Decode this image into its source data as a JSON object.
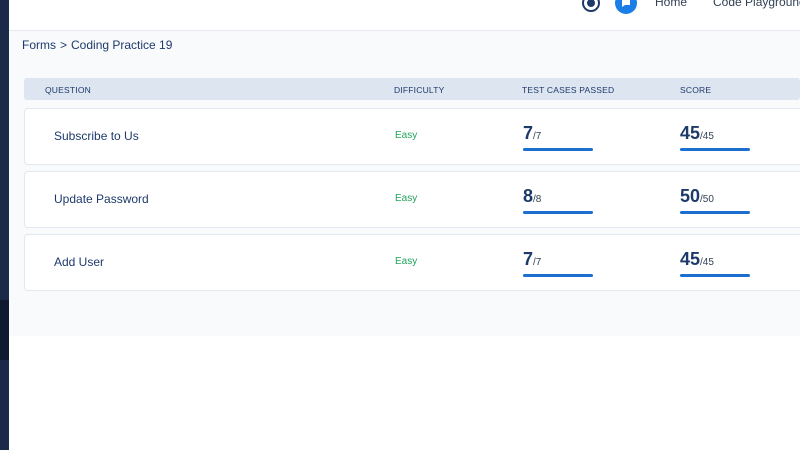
{
  "nav": {
    "links": [
      "Home",
      "Code Playground"
    ],
    "icons": [
      "streak-icon",
      "chat-icon"
    ]
  },
  "breadcrumb": {
    "parent": "Forms",
    "separator": ">",
    "current": "Coding Practice 19"
  },
  "table": {
    "headers": {
      "question": "QUESTION",
      "difficulty": "DIFFICULTY",
      "tests": "TEST CASES PASSED",
      "score": "SCORE"
    },
    "rows": [
      {
        "question": "Subscribe to Us",
        "difficulty": "Easy",
        "tests_passed": "7",
        "tests_total": "/7",
        "score": "45",
        "score_total": "/45",
        "tests_progress": 1,
        "score_progress": 1
      },
      {
        "question": "Update Password",
        "difficulty": "Easy",
        "tests_passed": "8",
        "tests_total": "/8",
        "score": "50",
        "score_total": "/50",
        "tests_progress": 1,
        "score_progress": 1
      },
      {
        "question": "Add User",
        "difficulty": "Easy",
        "tests_passed": "7",
        "tests_total": "/7",
        "score": "45",
        "score_total": "/45",
        "tests_progress": 1,
        "score_progress": 1
      }
    ]
  },
  "colors": {
    "accent": "#1a6fd1",
    "easy": "#22a55b",
    "text": "#1e3a6b"
  }
}
